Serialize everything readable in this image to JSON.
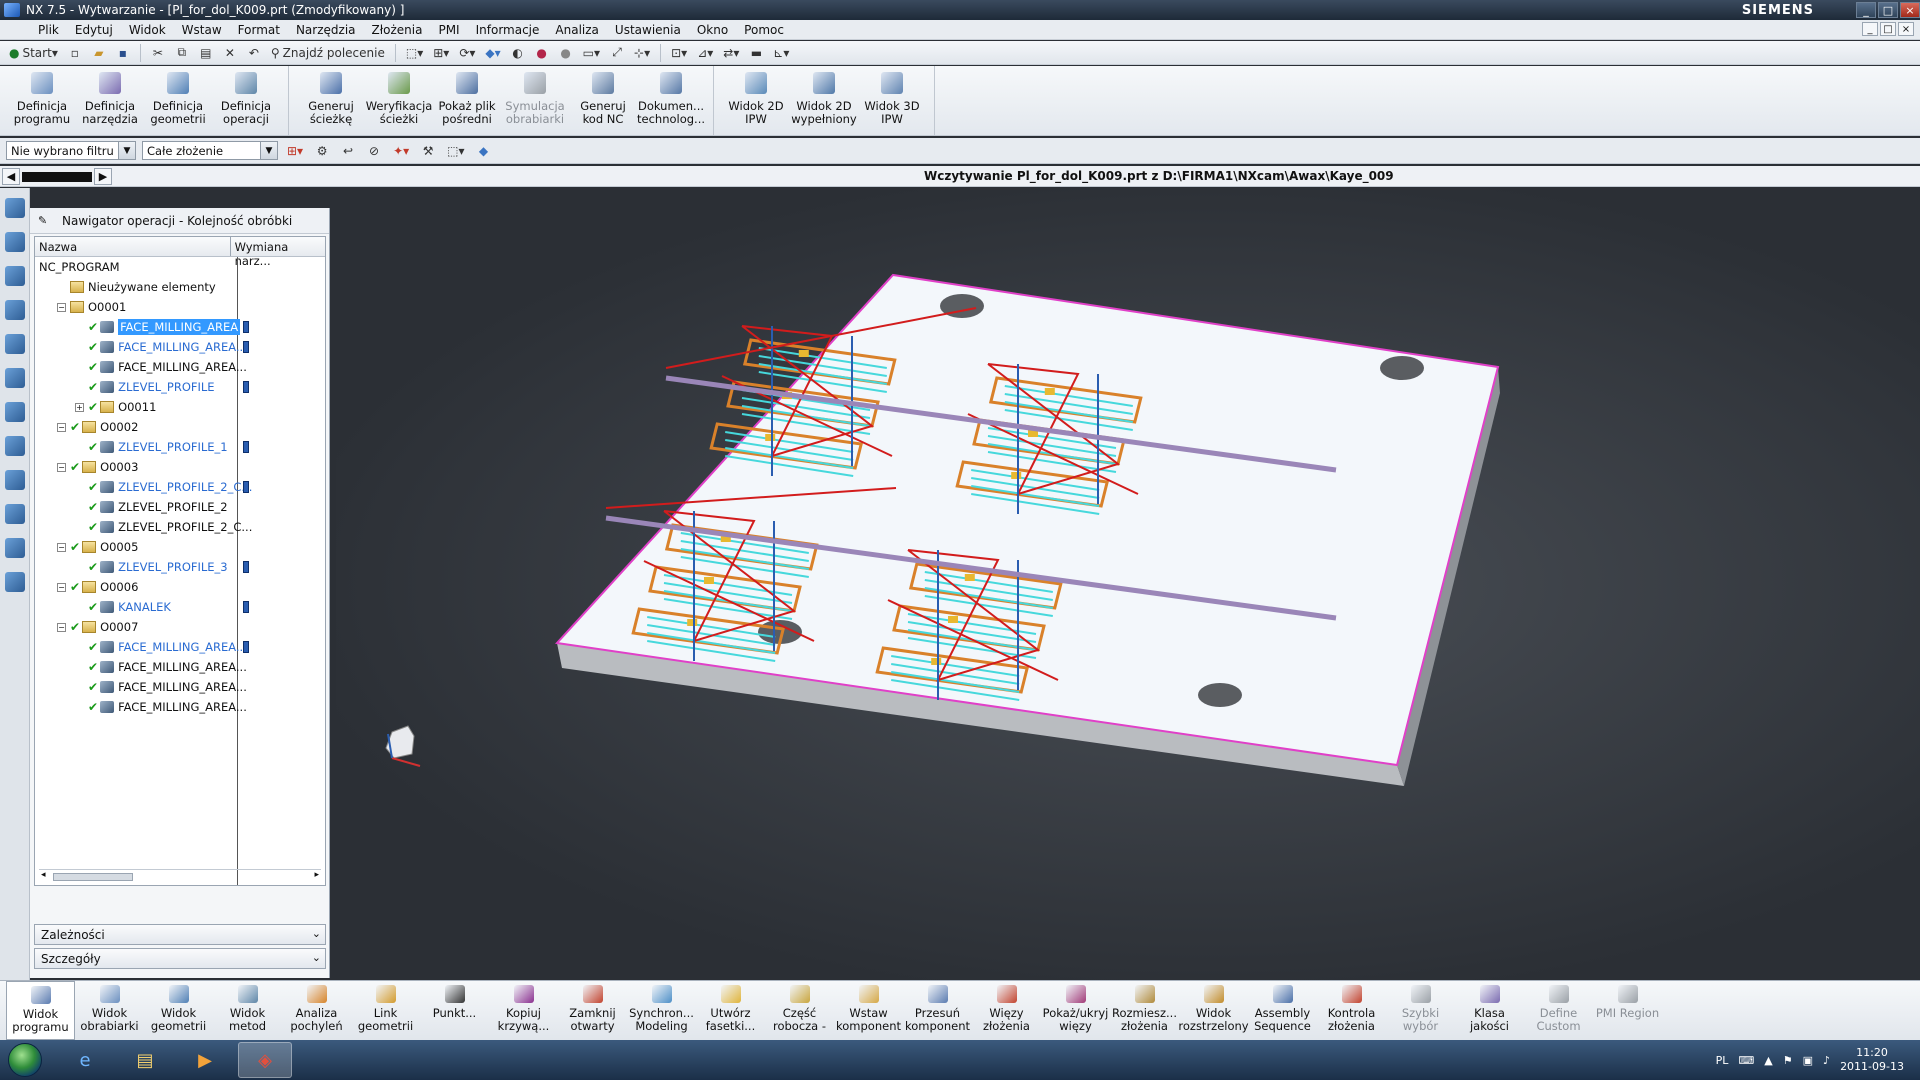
{
  "window": {
    "title": "NX 7.5 - Wytwarzanie - [Pl_for_dol_K009.prt (Zmodyfikowany) ]",
    "brand": "SIEMENS"
  },
  "menu": [
    "Plik",
    "Edytuj",
    "Widok",
    "Wstaw",
    "Format",
    "Narzędzia",
    "Złożenia",
    "PMI",
    "Informacje",
    "Analiza",
    "Ustawienia",
    "Okno",
    "Pomoc"
  ],
  "stdbar": {
    "start_label": "Start",
    "find_label": "Znajdź polecenie"
  },
  "bigbar": {
    "groups": [
      [
        "Definicja programu",
        "Definicja narzędzia",
        "Definicja geometrii",
        "Definicja operacji"
      ],
      [
        "Generuj ścieżkę",
        "Weryfikacja ścieżki",
        "Pokaż plik pośredni",
        "Symulacja obrabiarki",
        "Generuj kod NC",
        "Dokumen... technolog..."
      ],
      [
        "Widok 2D IPW",
        "Widok 2D wypełniony",
        "Widok 3D IPW"
      ]
    ]
  },
  "filterbar": {
    "filter_value": "Nie wybrano filtru",
    "assembly_value": "Całe złożenie"
  },
  "status": {
    "message": "Wczytywanie  Pl_for_dol_K009.prt z D:\\FIRMA1\\NXcam\\Awax\\Kaye_009"
  },
  "navigator": {
    "title": "Nawigator operacji - Kolejność obróbki",
    "col_name": "Nazwa",
    "col_tool": "Wymiana narz...",
    "rows": [
      {
        "label": "NC_PROGRAM",
        "indent": 0,
        "exp": "",
        "chk": false,
        "icon": "",
        "tool": false,
        "link": false,
        "sel": false
      },
      {
        "label": "Nieużywane elementy",
        "indent": 1,
        "exp": "",
        "chk": false,
        "icon": "folder",
        "tool": false,
        "link": false,
        "sel": false
      },
      {
        "label": "O0001",
        "indent": 1,
        "exp": "−",
        "chk": false,
        "icon": "folder",
        "tool": false,
        "link": false,
        "sel": false
      },
      {
        "label": "FACE_MILLING_AREA",
        "indent": 2,
        "exp": "",
        "chk": true,
        "icon": "op",
        "tool": true,
        "link": false,
        "sel": true
      },
      {
        "label": "FACE_MILLING_AREA...",
        "indent": 2,
        "exp": "",
        "chk": true,
        "icon": "op",
        "tool": true,
        "link": true,
        "sel": false
      },
      {
        "label": "FACE_MILLING_AREA...",
        "indent": 2,
        "exp": "",
        "chk": true,
        "icon": "op",
        "tool": false,
        "link": false,
        "sel": false
      },
      {
        "label": "ZLEVEL_PROFILE",
        "indent": 2,
        "exp": "",
        "chk": true,
        "icon": "op",
        "tool": true,
        "link": true,
        "sel": false
      },
      {
        "label": "O0011",
        "indent": 2,
        "exp": "+",
        "chk": true,
        "icon": "folder",
        "tool": false,
        "link": false,
        "sel": false
      },
      {
        "label": "O0002",
        "indent": 1,
        "exp": "−",
        "chk": true,
        "icon": "folder",
        "tool": false,
        "link": false,
        "sel": false
      },
      {
        "label": "ZLEVEL_PROFILE_1",
        "indent": 2,
        "exp": "",
        "chk": true,
        "icon": "op",
        "tool": true,
        "link": true,
        "sel": false
      },
      {
        "label": "O0003",
        "indent": 1,
        "exp": "−",
        "chk": true,
        "icon": "folder",
        "tool": false,
        "link": false,
        "sel": false
      },
      {
        "label": "ZLEVEL_PROFILE_2_C...",
        "indent": 2,
        "exp": "",
        "chk": true,
        "icon": "op",
        "tool": true,
        "link": true,
        "sel": false
      },
      {
        "label": "ZLEVEL_PROFILE_2",
        "indent": 2,
        "exp": "",
        "chk": true,
        "icon": "op",
        "tool": false,
        "link": false,
        "sel": false
      },
      {
        "label": "ZLEVEL_PROFILE_2_C...",
        "indent": 2,
        "exp": "",
        "chk": true,
        "icon": "op",
        "tool": false,
        "link": false,
        "sel": false
      },
      {
        "label": "O0005",
        "indent": 1,
        "exp": "−",
        "chk": true,
        "icon": "folder",
        "tool": false,
        "link": false,
        "sel": false
      },
      {
        "label": "ZLEVEL_PROFILE_3",
        "indent": 2,
        "exp": "",
        "chk": true,
        "icon": "op",
        "tool": true,
        "link": true,
        "sel": false
      },
      {
        "label": "O0006",
        "indent": 1,
        "exp": "−",
        "chk": true,
        "icon": "folder",
        "tool": false,
        "link": false,
        "sel": false
      },
      {
        "label": "KANALEK",
        "indent": 2,
        "exp": "",
        "chk": true,
        "icon": "op",
        "tool": true,
        "link": true,
        "sel": false
      },
      {
        "label": "O0007",
        "indent": 1,
        "exp": "−",
        "chk": true,
        "icon": "folder",
        "tool": false,
        "link": false,
        "sel": false
      },
      {
        "label": "FACE_MILLING_AREA...",
        "indent": 2,
        "exp": "",
        "chk": true,
        "icon": "op",
        "tool": true,
        "link": true,
        "sel": false
      },
      {
        "label": "FACE_MILLING_AREA...",
        "indent": 2,
        "exp": "",
        "chk": true,
        "icon": "op",
        "tool": false,
        "link": false,
        "sel": false
      },
      {
        "label": "FACE_MILLING_AREA...",
        "indent": 2,
        "exp": "",
        "chk": true,
        "icon": "op",
        "tool": false,
        "link": false,
        "sel": false
      },
      {
        "label": "FACE_MILLING_AREA...",
        "indent": 2,
        "exp": "",
        "chk": true,
        "icon": "op",
        "tool": false,
        "link": false,
        "sel": false
      }
    ],
    "dependencies": "Zależności",
    "details": "Szczegóły"
  },
  "bottombar": [
    "Widok programu",
    "Widok obrabiarki",
    "Widok geometrii",
    "Widok metod",
    "Analiza pochyleń",
    "Link geometrii",
    "Punkt...",
    "Kopiuj krzywą...",
    "Zamknij otwarty",
    "Synchron... Modeling",
    "Utwórz fasetki...",
    "Część robocza -",
    "Wstaw komponent",
    "Przesuń komponent",
    "Więzy złożenia",
    "Pokaż/ukryj więzy",
    "Rozmiesz... złożenia",
    "Widok rozstrzelony",
    "Assembly Sequence",
    "Kontrola złożenia",
    "Szybki wybór",
    "Klasa jakości",
    "Define Custom",
    "PMI Region"
  ],
  "taskbar": {
    "lang": "PL",
    "time": "11:20",
    "date": "2011-09-13"
  },
  "colors": {
    "accent": "#3399ff",
    "toolpath_red": "#d21c1c",
    "toolpath_cyan": "#46d8dc",
    "toolpath_orange": "#d9812a",
    "edge_magenta": "#e040c8"
  }
}
